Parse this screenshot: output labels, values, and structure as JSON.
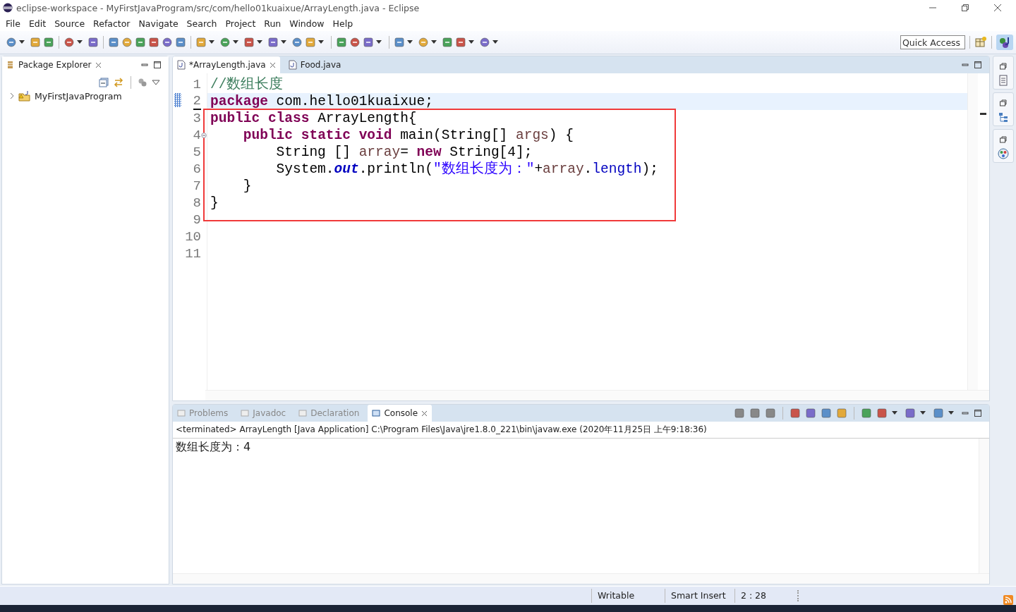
{
  "window": {
    "title": "eclipse-workspace - MyFirstJavaProgram/src/com/hello01kuaixue/ArrayLength.java - Eclipse"
  },
  "menu": [
    "File",
    "Edit",
    "Source",
    "Refactor",
    "Navigate",
    "Search",
    "Project",
    "Run",
    "Window",
    "Help"
  ],
  "quick_access": {
    "placeholder": "Quick Access"
  },
  "package_explorer": {
    "title": "Package Explorer",
    "tree": [
      {
        "label": "MyFirstJavaProgram",
        "expanded": false
      }
    ]
  },
  "editor": {
    "tabs": [
      {
        "label": "*ArrayLength.java",
        "selected": true
      },
      {
        "label": "Food.java",
        "selected": false
      }
    ],
    "lines": [
      {
        "number": "1",
        "current": false,
        "boxed": false,
        "foldable": false,
        "tokens": [
          {
            "kind": "comment",
            "text": "//数组长度"
          }
        ]
      },
      {
        "number": "2",
        "current": true,
        "boxed": false,
        "foldable": false,
        "tokens": [
          {
            "kind": "keyword",
            "text": "package"
          },
          {
            "kind": "plain",
            "text": " com.hello01kuaixue;"
          }
        ]
      },
      {
        "number": "3",
        "current": false,
        "boxed": true,
        "foldable": false,
        "tokens": [
          {
            "kind": "keyword",
            "text": "public"
          },
          {
            "kind": "keyword",
            "text": " class"
          },
          {
            "kind": "plain",
            "text": " ArrayLength{"
          }
        ]
      },
      {
        "number": "4",
        "current": false,
        "boxed": true,
        "foldable": true,
        "tokens": [
          {
            "kind": "keyword",
            "text": "    public"
          },
          {
            "kind": "keyword",
            "text": " static"
          },
          {
            "kind": "keyword",
            "text": " void"
          },
          {
            "kind": "plain",
            "text": " main(String[] "
          },
          {
            "kind": "variable",
            "text": "args"
          },
          {
            "kind": "plain",
            "text": ") {"
          }
        ]
      },
      {
        "number": "5",
        "current": false,
        "boxed": true,
        "foldable": false,
        "tokens": [
          {
            "kind": "plain",
            "text": "        String [] "
          },
          {
            "kind": "variable",
            "text": "array"
          },
          {
            "kind": "plain",
            "text": "= "
          },
          {
            "kind": "keyword",
            "text": "new"
          },
          {
            "kind": "plain",
            "text": " String[4];"
          }
        ]
      },
      {
        "number": "6",
        "current": false,
        "boxed": true,
        "foldable": false,
        "tokens": [
          {
            "kind": "plain",
            "text": "        System."
          },
          {
            "kind": "static_field",
            "text": "out"
          },
          {
            "kind": "plain",
            "text": ".println("
          },
          {
            "kind": "string",
            "text": "\"数组长度为：\""
          },
          {
            "kind": "plain",
            "text": "+"
          },
          {
            "kind": "variable",
            "text": "array"
          },
          {
            "kind": "plain",
            "text": "."
          },
          {
            "kind": "field",
            "text": "length"
          },
          {
            "kind": "plain",
            "text": ");"
          }
        ]
      },
      {
        "number": "7",
        "current": false,
        "boxed": true,
        "foldable": false,
        "tokens": [
          {
            "kind": "plain",
            "text": "    }"
          }
        ]
      },
      {
        "number": "8",
        "current": false,
        "boxed": true,
        "foldable": false,
        "tokens": [
          {
            "kind": "plain",
            "text": "}"
          }
        ]
      },
      {
        "number": "9",
        "current": false,
        "boxed": false,
        "foldable": false
      },
      {
        "number": "10",
        "current": false,
        "boxed": false,
        "foldable": false
      },
      {
        "number": "11",
        "current": false,
        "boxed": false,
        "foldable": false
      }
    ]
  },
  "console": {
    "tabs": [
      {
        "label": "Problems",
        "selected": false
      },
      {
        "label": "Javadoc",
        "selected": false
      },
      {
        "label": "Declaration",
        "selected": false
      },
      {
        "label": "Console",
        "selected": true
      }
    ],
    "status": "<terminated> ArrayLength [Java Application] C:\\Program Files\\Java\\jre1.8.0_221\\bin\\javaw.exe (2020年11月25日 上午9:18:36)",
    "output": [
      "数组长度为：4"
    ]
  },
  "status_bar": [
    "Writable",
    "Smart Insert",
    "2 : 28"
  ]
}
